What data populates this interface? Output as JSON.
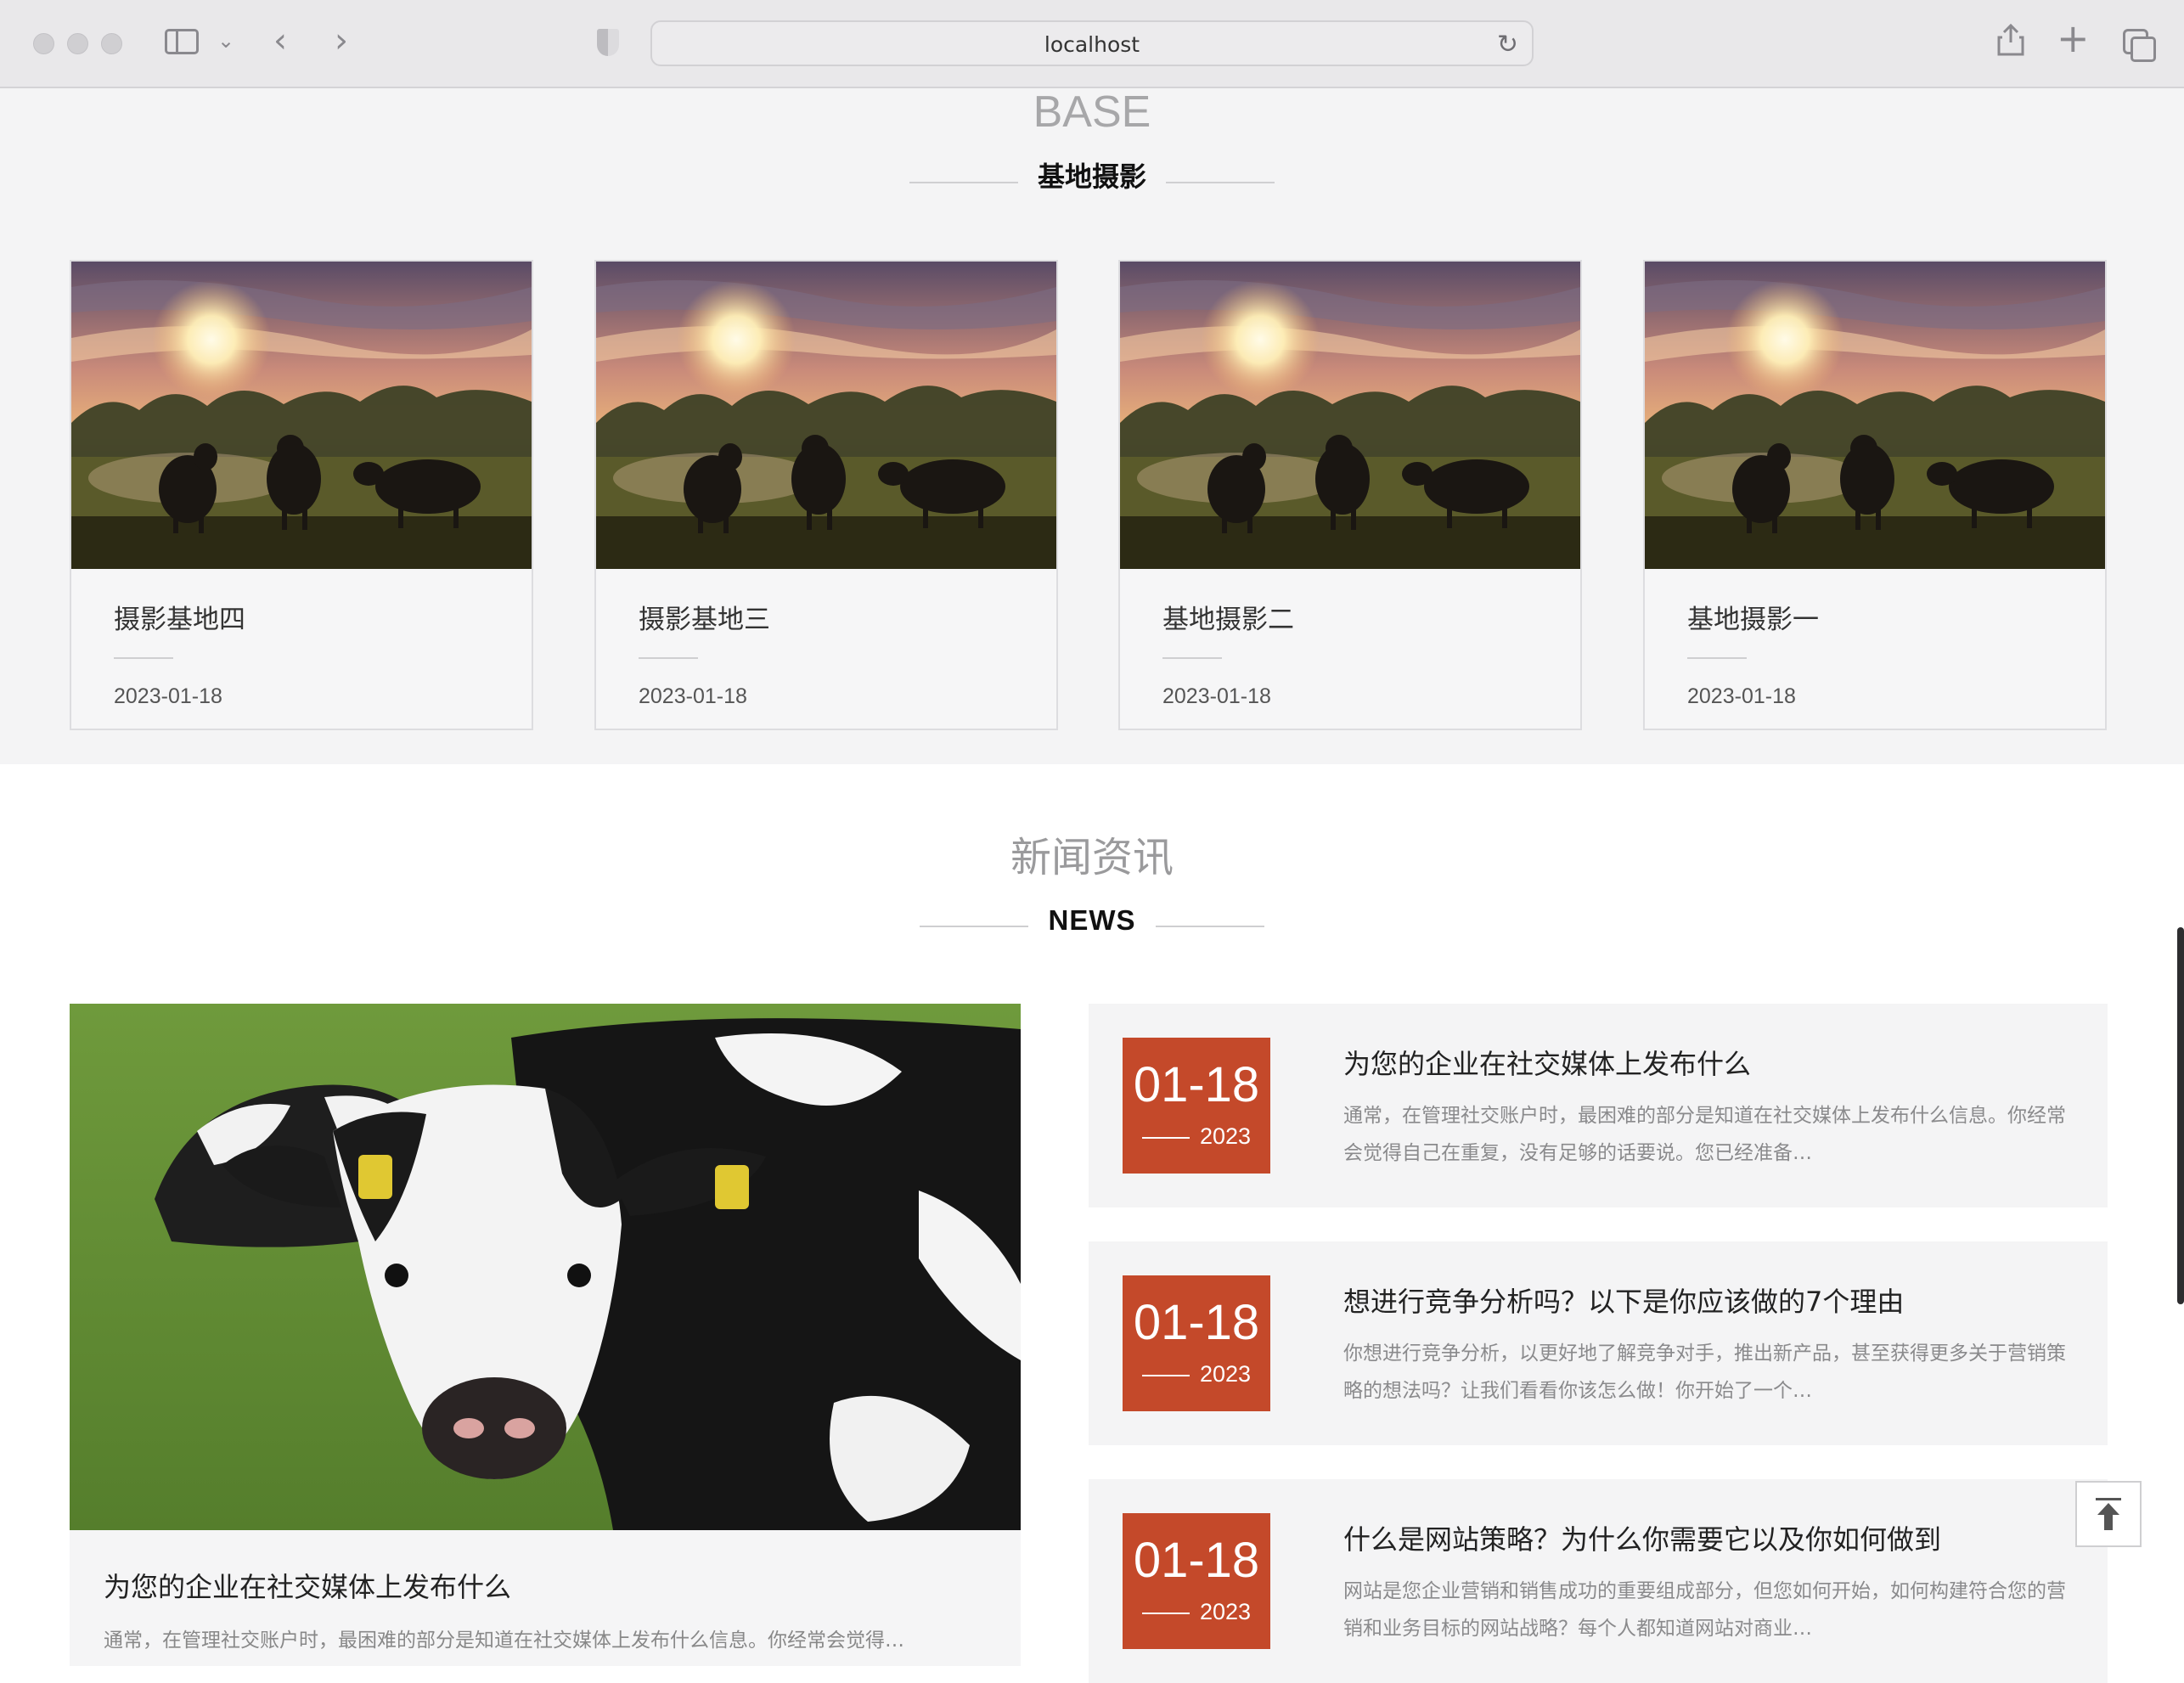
{
  "browser": {
    "url": "localhost",
    "icons": [
      "sidebar-icon",
      "chevron-down-icon",
      "back-icon",
      "forward-icon",
      "shield-icon",
      "reload-icon",
      "share-icon",
      "new-tab-icon",
      "tabs-overview-icon"
    ]
  },
  "base": {
    "heading_en": "BASE",
    "heading_cn": "基地摄影",
    "cards": [
      {
        "title": "摄影基地四",
        "date": "2023-01-18"
      },
      {
        "title": "摄影基地三",
        "date": "2023-01-18"
      },
      {
        "title": "基地摄影二",
        "date": "2023-01-18"
      },
      {
        "title": "基地摄影一",
        "date": "2023-01-18"
      }
    ]
  },
  "news": {
    "heading_cn": "新闻资讯",
    "heading_en": "NEWS",
    "featured": {
      "title": "为您的企业在社交媒体上发布什么",
      "excerpt": "通常，在管理社交账户时，最困难的部分是知道在社交媒体上发布什么信息。你经常会觉得…"
    },
    "items": [
      {
        "date_md": "01-18",
        "year": "2023",
        "title": "为您的企业在社交媒体上发布什么",
        "excerpt": "通常，在管理社交账户时，最困难的部分是知道在社交媒体上发布什么信息。你经常会觉得自己在重复，没有足够的话要说。您已经准备…"
      },
      {
        "date_md": "01-18",
        "year": "2023",
        "title": "想进行竞争分析吗？以下是你应该做的7个理由",
        "excerpt": "你想进行竞争分析，以更好地了解竞争对手，推出新产品，甚至获得更多关于营销策略的想法吗？让我们看看你该怎么做！你开始了一个…"
      },
      {
        "date_md": "01-18",
        "year": "2023",
        "title": "什么是网站策略？为什么你需要它以及你如何做到",
        "excerpt": "网站是您企业营销和销售成功的重要组成部分，但您如何开始，如何构建符合您的营销和业务目标的网站战略？每个人都知道网站对商业…"
      }
    ]
  },
  "colors": {
    "accent": "#c4492a",
    "section_bg": "#f4f4f5"
  }
}
